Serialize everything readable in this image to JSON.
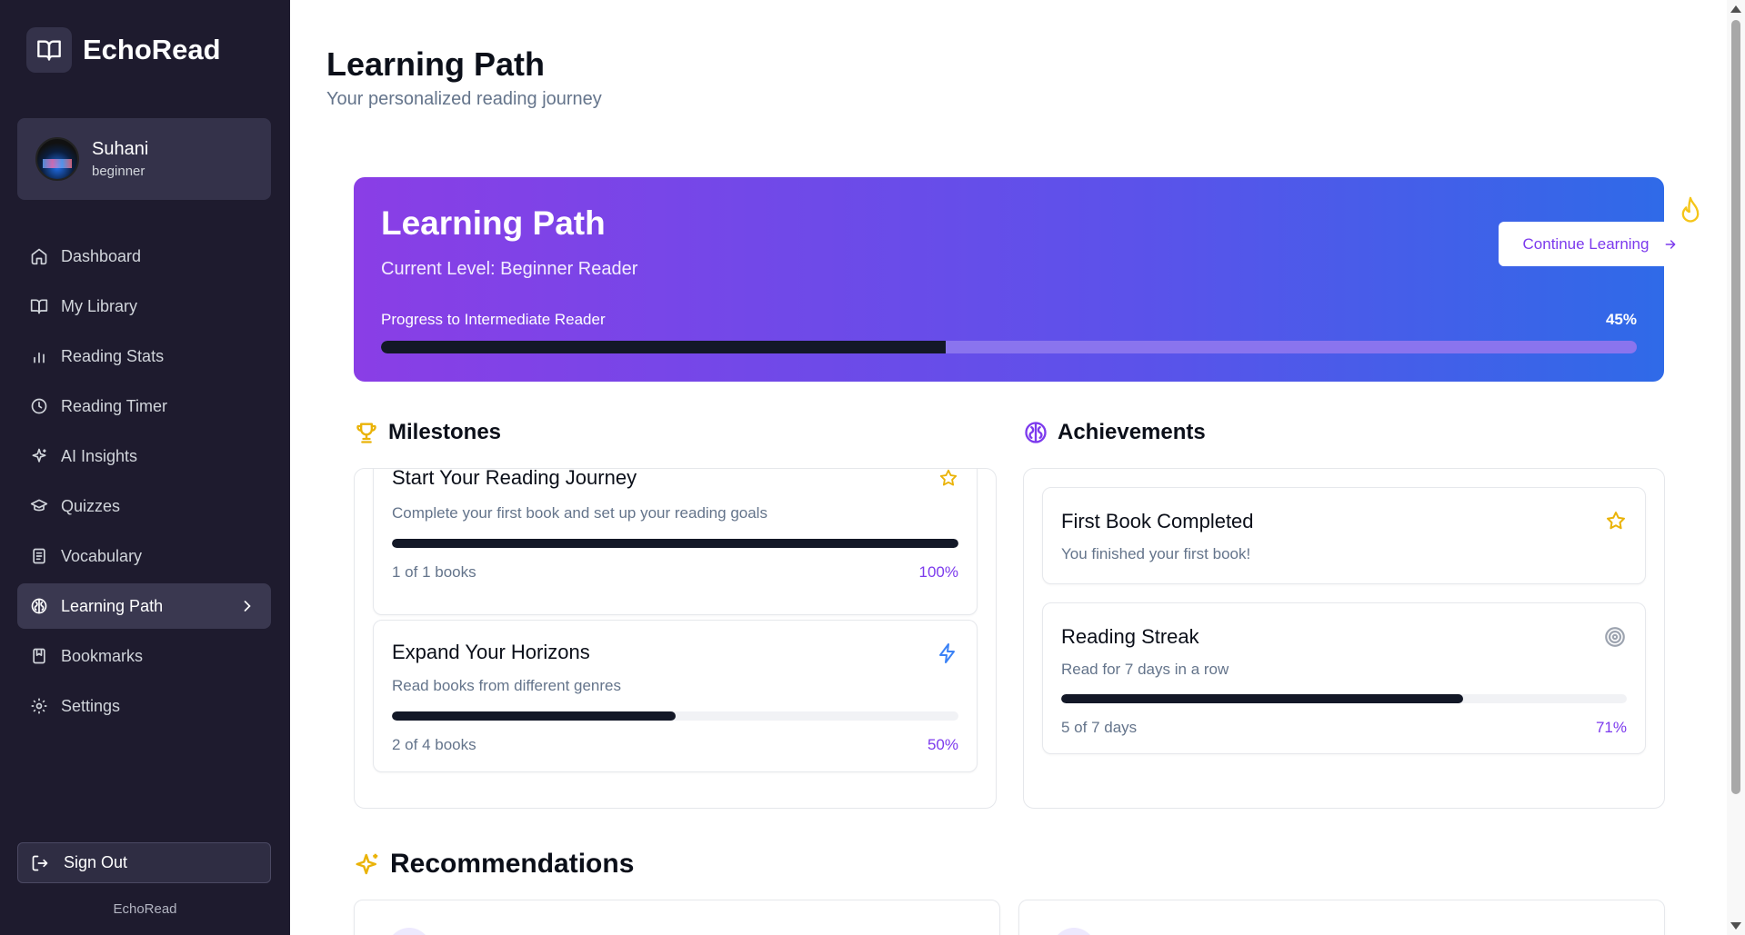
{
  "brand": {
    "name": "EchoRead",
    "footer": "EchoRead"
  },
  "user": {
    "name": "Suhani",
    "level": "beginner"
  },
  "nav": [
    {
      "label": "Dashboard",
      "icon": "home-icon"
    },
    {
      "label": "My Library",
      "icon": "book-open-icon"
    },
    {
      "label": "Reading Stats",
      "icon": "bar-chart-icon"
    },
    {
      "label": "Reading Timer",
      "icon": "clock-icon"
    },
    {
      "label": "AI Insights",
      "icon": "sparkles-icon"
    },
    {
      "label": "Quizzes",
      "icon": "graduation-cap-icon"
    },
    {
      "label": "Vocabulary",
      "icon": "notebook-icon"
    },
    {
      "label": "Learning Path",
      "icon": "brain-icon",
      "active": true
    },
    {
      "label": "Bookmarks",
      "icon": "bookmark-icon"
    },
    {
      "label": "Settings",
      "icon": "gear-icon"
    }
  ],
  "signout": {
    "label": "Sign Out"
  },
  "page": {
    "title": "Learning Path",
    "subtitle": "Your personalized reading journey"
  },
  "hero": {
    "title": "Learning Path",
    "current_level": "Current Level: Beginner Reader",
    "progress_label": "Progress to Intermediate Reader",
    "progress_pct_label": "45%",
    "progress": 0.45,
    "button_label": "Continue Learning"
  },
  "milestones": {
    "title": "Milestones",
    "items": [
      {
        "title": "Start Your Reading Journey",
        "desc": "Complete your first book and set up your reading goals",
        "count": "1 of 1 books",
        "pct_label": "100%",
        "progress": 1.0,
        "icon": "star-icon"
      },
      {
        "title": "Expand Your Horizons",
        "desc": "Read books from different genres",
        "count": "2 of 4 books",
        "pct_label": "50%",
        "progress": 0.5,
        "icon": "lightning-icon"
      }
    ]
  },
  "achievements": {
    "title": "Achievements",
    "items": [
      {
        "title": "First Book Completed",
        "desc": "You finished your first book!",
        "icon": "star-icon"
      },
      {
        "title": "Reading Streak",
        "desc": "Read for 7 days in a row",
        "count": "5 of 7 days",
        "pct_label": "71%",
        "progress": 0.71,
        "icon": "target-icon"
      }
    ]
  },
  "recommendations": {
    "title": "Recommendations"
  },
  "colors": {
    "accent": "#7c3aed",
    "sidebar": "#1e1b2e",
    "bar": "#131827",
    "gold": "#eab308",
    "blue": "#3b82f6"
  }
}
